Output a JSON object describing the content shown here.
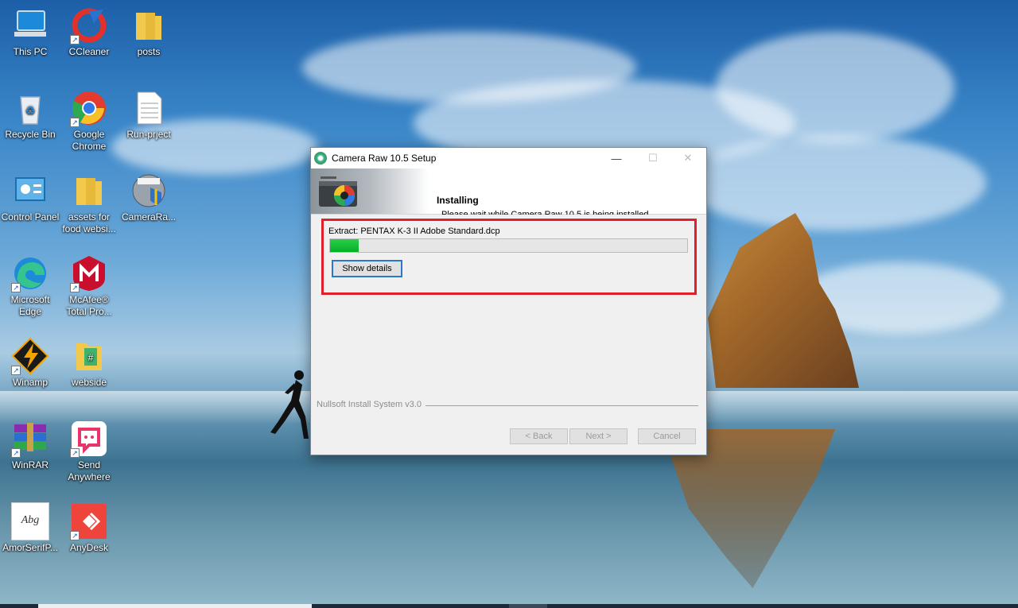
{
  "desktop": {
    "icons": [
      {
        "label": "This PC",
        "icon": "computer-icon",
        "shortcut": false
      },
      {
        "label": "CCleaner",
        "icon": "ccleaner-icon",
        "shortcut": true
      },
      {
        "label": "posts",
        "icon": "folder-icon",
        "shortcut": false
      },
      {
        "label": "Recycle Bin",
        "icon": "recycle-bin-icon",
        "shortcut": false
      },
      {
        "label": "Google Chrome",
        "icon": "chrome-icon",
        "shortcut": true
      },
      {
        "label": "Run-prject",
        "icon": "text-file-icon",
        "shortcut": false
      },
      {
        "label": "Control Panel",
        "icon": "control-panel-icon",
        "shortcut": false
      },
      {
        "label": "assets for food websi...",
        "icon": "folder-icon",
        "shortcut": false
      },
      {
        "label": "CameraRa...",
        "icon": "installer-icon",
        "shortcut": false
      },
      {
        "label": "Microsoft Edge",
        "icon": "edge-icon",
        "shortcut": true
      },
      {
        "label": "McAfee® Total Pro...",
        "icon": "mcafee-icon",
        "shortcut": true
      },
      {
        "label": "Winamp",
        "icon": "winamp-icon",
        "shortcut": true
      },
      {
        "label": "webside",
        "icon": "folder-icon",
        "shortcut": false
      },
      {
        "label": "WinRAR",
        "icon": "winrar-icon",
        "shortcut": true
      },
      {
        "label": "Send Anywhere",
        "icon": "send-anywhere-icon",
        "shortcut": true
      },
      {
        "label": "AmorSerifP...",
        "icon": "font-file-icon",
        "shortcut": false,
        "glyph_text": "Abg"
      },
      {
        "label": "AnyDesk",
        "icon": "anydesk-icon",
        "shortcut": true
      }
    ]
  },
  "window": {
    "title": "Camera Raw 10.5 Setup",
    "controls": {
      "minimize": "—",
      "maximize": "☐",
      "close": "✕"
    },
    "header": {
      "title": "Installing",
      "subtitle": "Please wait while Camera Raw 10.5 is being installed."
    },
    "body": {
      "status_text": "Extract: PENTAX K-3 II Adobe Standard.dcp",
      "progress_percent": 8,
      "show_details_label": "Show details"
    },
    "branding": "Nullsoft Install System v3.0",
    "buttons": {
      "back": "< Back",
      "next": "Next >",
      "cancel": "Cancel"
    }
  },
  "colors": {
    "highlight_border": "#e0202a",
    "progress_fill": "#06b025",
    "focus_border": "#2a78c8"
  }
}
